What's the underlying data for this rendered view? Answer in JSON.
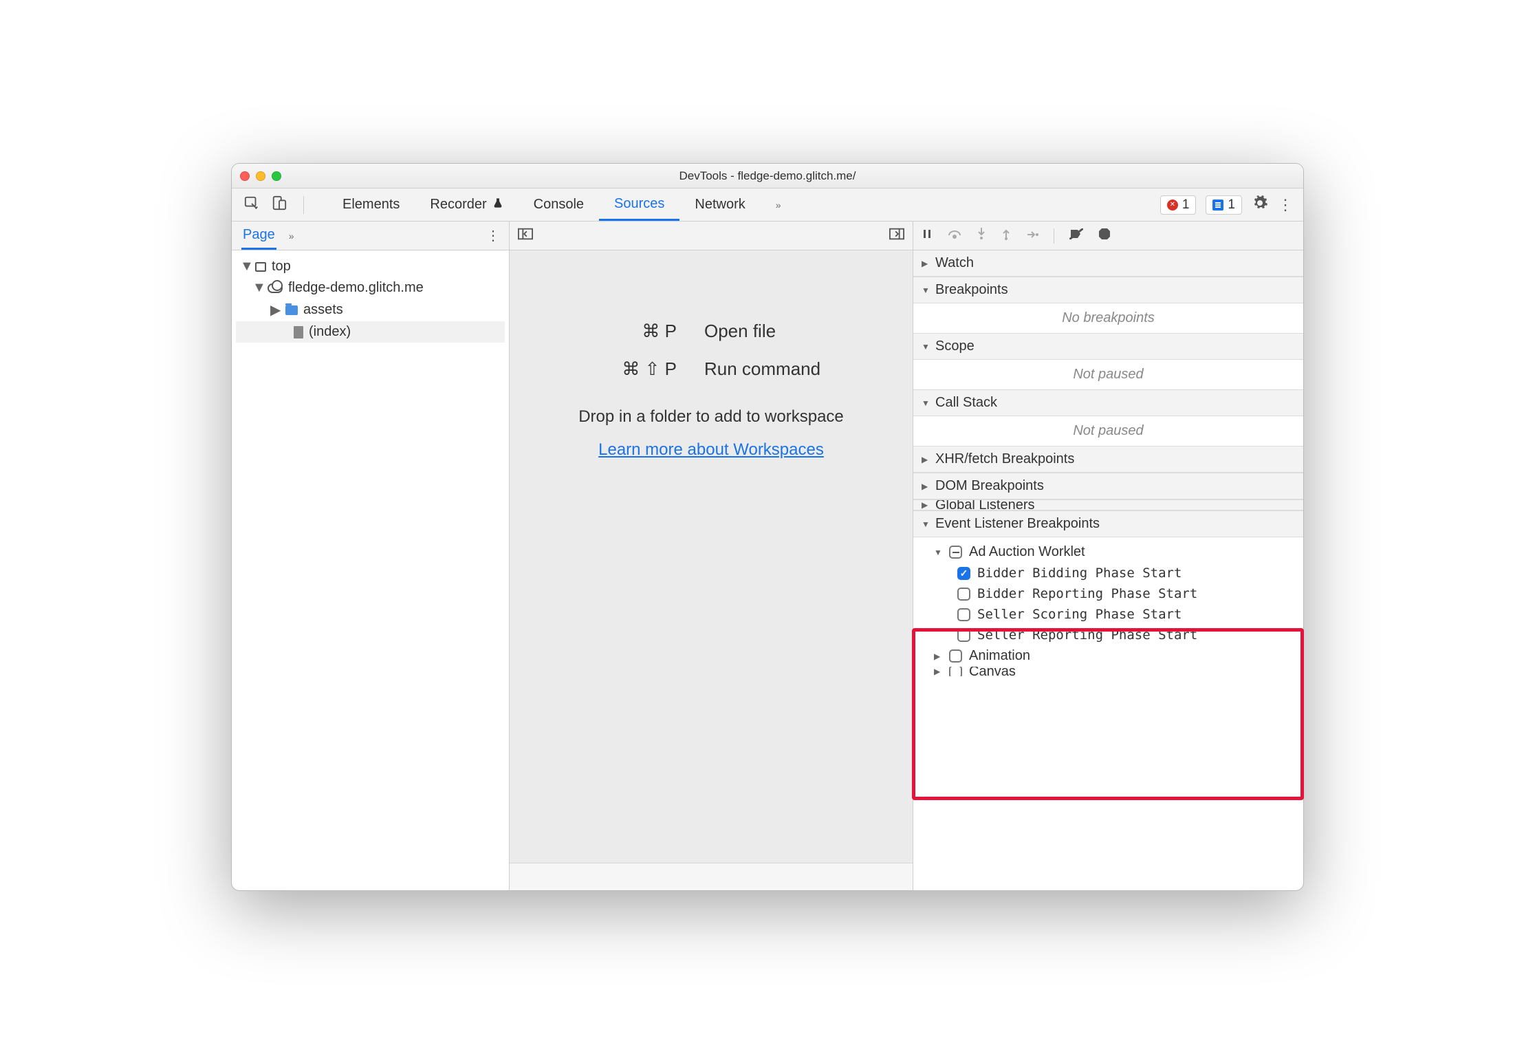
{
  "window": {
    "title": "DevTools - fledge-demo.glitch.me/"
  },
  "tabs": {
    "elements": "Elements",
    "recorder": "Recorder",
    "console": "Console",
    "sources": "Sources",
    "network": "Network"
  },
  "toolbar_badges": {
    "errors": "1",
    "messages": "1"
  },
  "left": {
    "tab": "Page",
    "tree": {
      "top": "top",
      "origin": "fledge-demo.glitch.me",
      "folder": "assets",
      "file": "(index)"
    }
  },
  "middle": {
    "open_file_keys": "⌘ P",
    "open_file_label": "Open file",
    "run_cmd_keys": "⌘ ⇧ P",
    "run_cmd_label": "Run command",
    "drop_hint": "Drop in a folder to add to workspace",
    "learn_link": "Learn more about Workspaces"
  },
  "right": {
    "sections": {
      "watch": "Watch",
      "breakpoints": "Breakpoints",
      "breakpoints_empty": "No breakpoints",
      "scope": "Scope",
      "scope_empty": "Not paused",
      "callstack": "Call Stack",
      "callstack_empty": "Not paused",
      "xhr": "XHR/fetch Breakpoints",
      "dom": "DOM Breakpoints",
      "global": "Global Listeners",
      "elb": "Event Listener Breakpoints",
      "ad_auction": "Ad Auction Worklet",
      "b1": "Bidder Bidding Phase Start",
      "b2": "Bidder Reporting Phase Start",
      "b3": "Seller Scoring Phase Start",
      "b4": "Seller Reporting Phase Start",
      "animation": "Animation",
      "canvas": "Canvas"
    }
  }
}
